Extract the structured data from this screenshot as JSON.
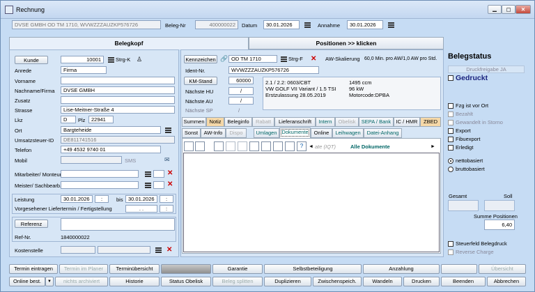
{
  "window": {
    "title": "Rechnung"
  },
  "header": {
    "customer_vehicle": "DVSE GMBH OD TM 1710, WVWZZZAUZKP576726",
    "beleg_nr_label": "Beleg-Nr",
    "beleg_nr": "400000022",
    "datum_label": "Datum",
    "datum": "30.01.2026",
    "annahme_label": "Annahme",
    "annahme": "30.01.2026"
  },
  "tabs_main": {
    "belegkopf": "Belegkopf",
    "positionen": "Positionen >> klicken"
  },
  "customer": {
    "kunde_button": "Kunde",
    "kunde_nr": "10001",
    "strg_k": "Strg-K",
    "anrede_label": "Anrede",
    "anrede": "Firma",
    "vorname_label": "Vorname",
    "vorname": "",
    "name_label": "Nachname/Firma",
    "name": "DVSE GMBH",
    "zusatz_label": "Zusatz",
    "zusatz": "",
    "strasse_label": "Strasse",
    "strasse": "Lise-Meitner-Straße 4",
    "lkz_label": "Lkz",
    "lkz": "D",
    "plz_label": "Plz",
    "plz": "22941",
    "ort_label": "Ort",
    "ort": "Bargteheide",
    "ust_label": "Umsatzsteuer-ID",
    "ust": "DE811741516",
    "telefon_label": "Telefon",
    "telefon": "+49 4532 9740 01",
    "mobil_label": "Mobil",
    "mobil": "",
    "sms": "SMS",
    "mitarbeiter_label": "Mitarbeiter/ Monteur",
    "meister_label": "Meister/ Sachbearb.",
    "leistung_label": "Leistung",
    "leistung_von": "30.01.2026",
    "bis_label": "bis",
    "leistung_bis": "30.01.2026",
    "liefertermin_label": "Vorgesehener Liefertermin / Fertigstellung",
    "liefertermin": ". .",
    "referenz_button": "Referenz",
    "ref_nr_label": "Ref-Nr.",
    "ref_nr": "1840000022",
    "kostenstelle_label": "Kostenstelle"
  },
  "vehicle": {
    "kennzeichen_button": "Kennzeichen",
    "kennzeichen": "OD TM 1710",
    "strg_f": "Strg-F",
    "aw_skalierung": "AW-Skalierung",
    "aw_value": "60,0 Min. pro AW/1,0 AW pro Std.",
    "ident_label": "Ident-Nr.",
    "ident": "WVWZZZAUZKP576726",
    "km_button": "KM-Stand",
    "km": "60000",
    "hu_label": "Nächste HU",
    "au_label": "Nächste AU",
    "sp_label": "Nächste SP",
    "info1": "2.1 / 2.2: 0603/CBT",
    "info2": "VW GOLF VII Variant / 1.5 TSI",
    "info3": "Erstzulassung 28.05.2019",
    "info4": "1495 ccm",
    "info5": "96 kW",
    "info6": "Motorcode:DPBA"
  },
  "tabs_row1": [
    "Summen",
    "Notiz",
    "Beleginfo",
    "Rabatt",
    "Lieferanschrift",
    "Intern",
    "Obelisk",
    "SEPA / Bank",
    "IC / HMR",
    "ZBED"
  ],
  "tabs_row2": [
    "Sonst",
    "AW-Info",
    "Dispo",
    "Umlagen",
    "Dokumente",
    "Online",
    "Leihwagen",
    "Datei-Anhang"
  ],
  "documents": {
    "partial_label": "ate (IQT)",
    "all_label": "Alle Dokumente"
  },
  "status": {
    "title": "Belegstatus",
    "druckfreigabe": "Druckfreigabe JA",
    "gedruckt": "Gedruckt",
    "checks": [
      "Fzg ist vor Ort",
      "Bezahlt",
      "Gewandelt in Storno",
      "Export",
      "Fibuexport",
      "Erledigt"
    ],
    "radio_netto": "nettobasiert",
    "radio_brutto": "bruttobasiert",
    "gesamt_label": "Gesamt",
    "soll_label": "Soll",
    "summe_label": "Summe Positionen",
    "summe": "6,40",
    "steuerfeld": "Steuerfeld Belegdruck",
    "reverse": "Reverse Charge"
  },
  "bottom_row1": [
    "Termin eintragen",
    "Termin im Planer",
    "Terminübersicht",
    "",
    "Garantie",
    "Selbstbeteiligung",
    "Anzahlung",
    "",
    "Übersicht"
  ],
  "bottom_row2": [
    "Online best.",
    "nichts archiviert",
    "Historie",
    "Status Obelisk",
    "Beleg splitten",
    "Duplizieren",
    "Zwischenspeich.",
    "Wandeln",
    "Drucken",
    "Beenden",
    "Abbrechen"
  ]
}
